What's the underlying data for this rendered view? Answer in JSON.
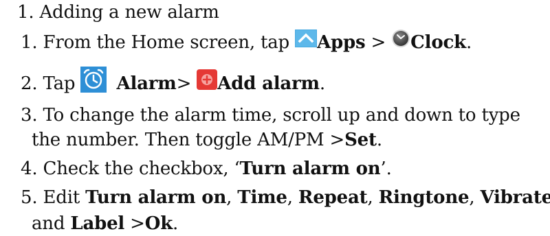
{
  "heading": "1. Adding a new alarm",
  "steps": [
    {
      "number": "1.",
      "pre": "From the Home screen, tap ",
      "apps_label": "Apps",
      "separator": " >",
      "clock_label": "Clock",
      "end": "."
    },
    {
      "number": "2.",
      "pre": "Tap ",
      "alarm_label": "Alarm",
      "separator": "> ",
      "add_label": "Add alarm",
      "end": "."
    },
    {
      "number": "3.",
      "line1": "To change the alarm time, scroll up and down to type",
      "line2_pre": "the number. Then toggle AM/PM >",
      "set_label": "Set",
      "end": "."
    },
    {
      "number": "4.",
      "pre": "Check the checkbox, ‘",
      "bold": "Turn alarm on",
      "end": "’."
    },
    {
      "number": "5.",
      "pre": "Edit ",
      "b1": "Turn alarm on",
      "c1": ", ",
      "b2": "Time",
      "c2": ", ",
      "b3": "Repeat",
      "c3": ", ",
      "b4": "Ringtone",
      "c4": ", ",
      "b5": "Vibrate",
      "line2_pre": "and ",
      "b6": "Label",
      "line2_mid": " >",
      "b7": "Ok",
      "end": "."
    }
  ],
  "icons": {
    "apps": "apps-chevron-up-icon",
    "clock": "clock-icon",
    "alarm": "alarm-clock-icon",
    "add_alarm": "add-plus-icon"
  },
  "colors": {
    "apps_icon": "#47a9e0",
    "alarm_icon": "#2e8fd6",
    "add_icon": "#e53935",
    "text": "#111111"
  }
}
